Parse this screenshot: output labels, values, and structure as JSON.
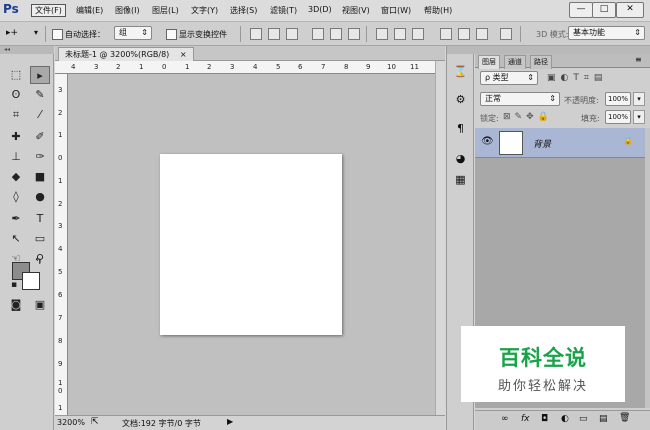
{
  "app": {
    "logo": "Ps"
  },
  "menu": [
    "文件(F)",
    "编辑(E)",
    "图像(I)",
    "图层(L)",
    "文字(Y)",
    "选择(S)",
    "滤镜(T)",
    "3D(D)",
    "视图(V)",
    "窗口(W)",
    "帮助(H)"
  ],
  "window_controls": {
    "minimize": "—",
    "restore": "□",
    "close": "✕"
  },
  "options": {
    "move_icon": "▸+",
    "auto_select_label": "自动选择：",
    "auto_select_value": "组",
    "show_transform_label": "显示变换控件",
    "mode_3d_label": "3D 模式:",
    "workspace": "基本功能"
  },
  "toolbar_grip": "◂◂",
  "document": {
    "tab_title": "未标题-1 @ 3200%(RGB/8)",
    "tab_close": "×",
    "ruler_top": [
      "4",
      "3",
      "2",
      "1",
      "0",
      "1",
      "2",
      "3",
      "4",
      "5",
      "6",
      "7",
      "8",
      "9",
      "10",
      "11"
    ],
    "ruler_left": [
      "3",
      "2",
      "1",
      "0",
      "1",
      "2",
      "3",
      "4",
      "5",
      "6",
      "7",
      "8",
      "9",
      "1\n0",
      "1"
    ],
    "zoom": "3200%",
    "doc_info": "文档:192 字节/0 字节"
  },
  "layers_panel": {
    "tabs": [
      "图层",
      "通道",
      "路径"
    ],
    "filter_label": "ρ 类型",
    "blend_mode": "正常",
    "opacity_label": "不透明度:",
    "opacity_value": "100%",
    "lock_label": "锁定:",
    "fill_label": "填充:",
    "fill_value": "100%",
    "layer_name": "背景",
    "visibility_icon": "👁",
    "lock_icon": "🔒",
    "bottom_icons": [
      "∞",
      "fx",
      "◘",
      "◐",
      "▭",
      "▤",
      "🗑"
    ]
  },
  "watermark": {
    "title": "百科全说",
    "subtitle": "助你轻松解决"
  },
  "colors": {
    "foreground": "#8c8c8c",
    "background": "#ffffff",
    "layer_selected": "#aab7d4",
    "watermark_green": "#1aa24a"
  }
}
